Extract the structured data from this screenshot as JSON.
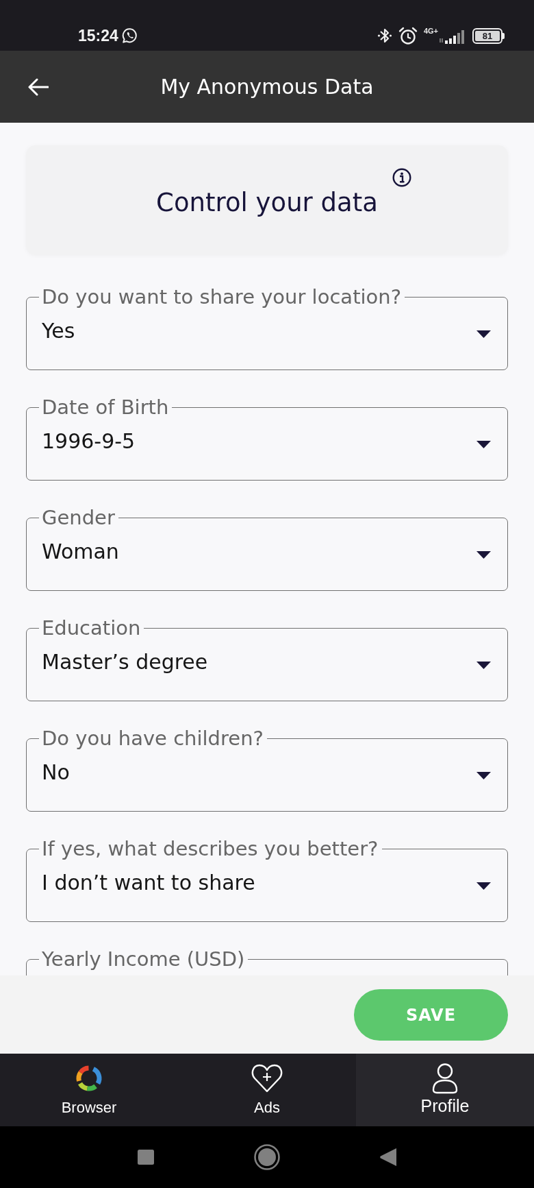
{
  "status_bar": {
    "time": "15:24",
    "network": "4G+",
    "battery": "81"
  },
  "app_bar": {
    "title": "My Anonymous Data"
  },
  "intro_card": {
    "title": "Control your data"
  },
  "fields": [
    {
      "label": "Do you want to share your location?",
      "value": "Yes"
    },
    {
      "label": "Date of Birth",
      "value": "1996-9-5"
    },
    {
      "label": "Gender",
      "value": "Woman"
    },
    {
      "label": "Education",
      "value": "Master’s degree"
    },
    {
      "label": "Do you have children?",
      "value": "No"
    },
    {
      "label": "If yes, what describes you better?",
      "value": "I don’t want to share"
    },
    {
      "label": "Yearly Income (USD)"
    }
  ],
  "save_button": {
    "label": "SAVE"
  },
  "bottom_nav": [
    {
      "label": "Browser",
      "selected": false
    },
    {
      "label": "Ads",
      "selected": false
    },
    {
      "label": "Profile",
      "selected": true
    }
  ]
}
